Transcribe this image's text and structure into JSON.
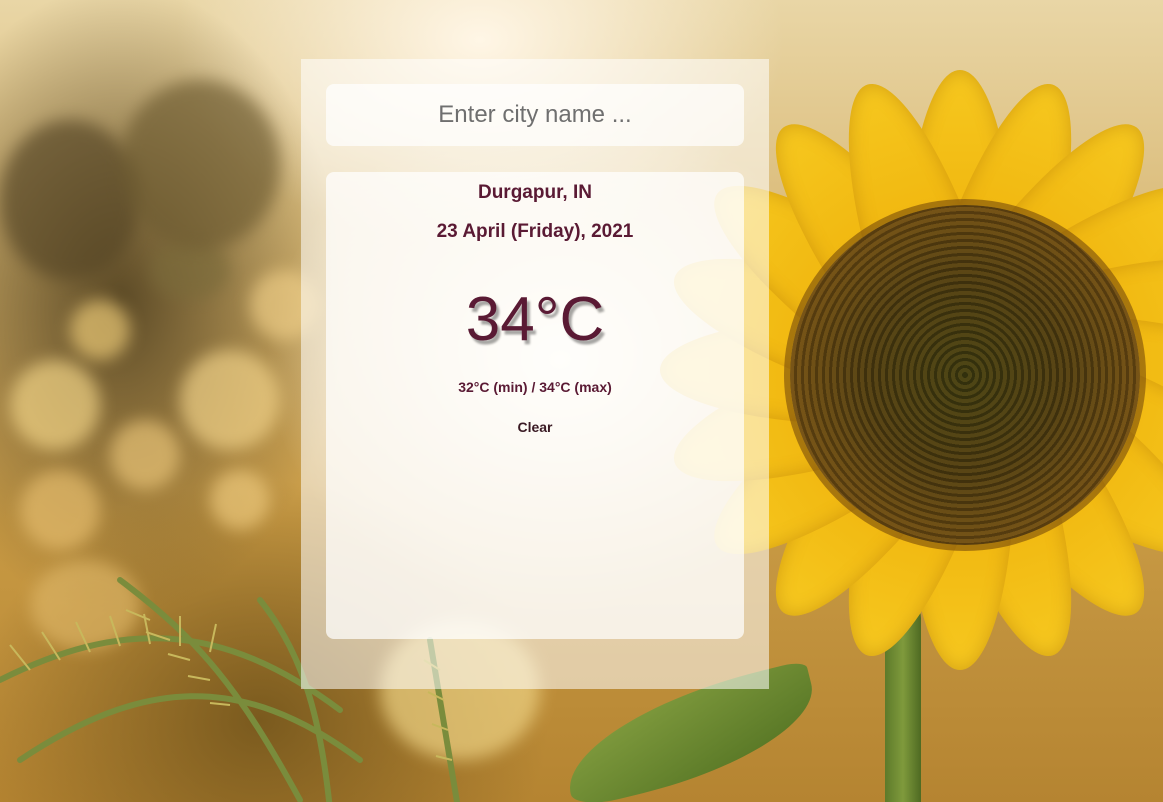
{
  "search": {
    "placeholder": "Enter city name ...",
    "value": ""
  },
  "weather": {
    "location": "Durgapur, IN",
    "date": "23 April (Friday), 2021",
    "temperature": "34°C",
    "range": "32°C (min) / 34°C (max)",
    "condition": "Clear"
  },
  "colors": {
    "text_primary": "#5a1a34",
    "panel_glass": "rgba(255,255,255,0.55)"
  }
}
